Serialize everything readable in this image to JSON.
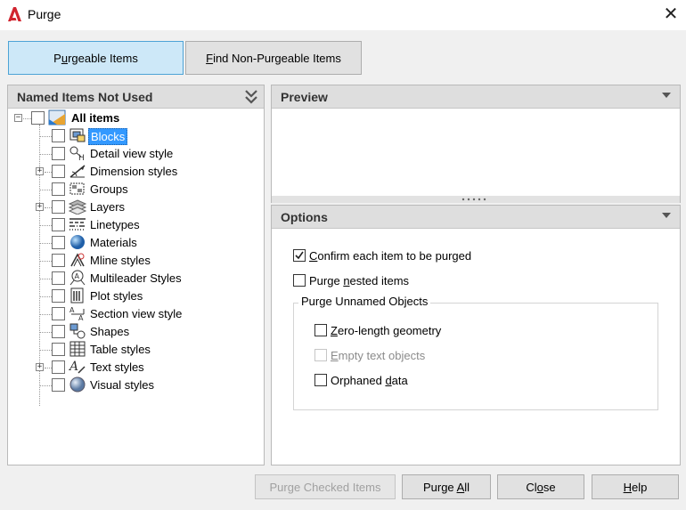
{
  "window": {
    "title": "Purge",
    "close_glyph": "✕"
  },
  "tabs": [
    {
      "label": "Purgeable Items",
      "mnemonic": "u",
      "active": true
    },
    {
      "label": "Find Non-Purgeable Items",
      "mnemonic": "F",
      "active": false
    }
  ],
  "left_panel": {
    "header": "Named Items Not Used",
    "tree": {
      "root_label": "All items",
      "items": [
        {
          "label": "Blocks",
          "icon": "block-icon",
          "expandable": false,
          "selected": true
        },
        {
          "label": "Detail view style",
          "icon": "detail-view-style-icon",
          "expandable": false
        },
        {
          "label": "Dimension styles",
          "icon": "dimension-styles-icon",
          "expandable": true
        },
        {
          "label": "Groups",
          "icon": "groups-icon",
          "expandable": false
        },
        {
          "label": "Layers",
          "icon": "layers-icon",
          "expandable": true
        },
        {
          "label": "Linetypes",
          "icon": "linetypes-icon",
          "expandable": false
        },
        {
          "label": "Materials",
          "icon": "materials-icon",
          "expandable": false
        },
        {
          "label": "Mline styles",
          "icon": "mline-styles-icon",
          "expandable": false
        },
        {
          "label": "Multileader Styles",
          "icon": "multileader-styles-icon",
          "expandable": false
        },
        {
          "label": "Plot styles",
          "icon": "plot-styles-icon",
          "expandable": false
        },
        {
          "label": "Section view style",
          "icon": "section-view-style-icon",
          "expandable": false
        },
        {
          "label": "Shapes",
          "icon": "shapes-icon",
          "expandable": false
        },
        {
          "label": "Table styles",
          "icon": "table-styles-icon",
          "expandable": false
        },
        {
          "label": "Text styles",
          "icon": "text-styles-icon",
          "expandable": true
        },
        {
          "label": "Visual styles",
          "icon": "visual-styles-icon",
          "expandable": false
        }
      ]
    }
  },
  "preview_panel": {
    "header": "Preview"
  },
  "options_panel": {
    "header": "Options",
    "confirm_each": {
      "label": "Confirm each item to be purged",
      "checked": true
    },
    "purge_nested": {
      "label": "Purge nested items",
      "checked": false
    },
    "unnamed_group": {
      "title": "Purge Unnamed Objects",
      "zero_length": {
        "label": "Zero-length geometry",
        "checked": false,
        "enabled": true
      },
      "empty_text": {
        "label": "Empty text objects",
        "checked": false,
        "enabled": false
      },
      "orphaned": {
        "label": "Orphaned data",
        "checked": false,
        "enabled": true
      }
    }
  },
  "buttons": {
    "purge_checked": "Purge Checked Items",
    "purge_all": "Purge All",
    "close": "Close",
    "help": "Help"
  },
  "colors": {
    "accent": "#3399ff",
    "active_tab": "#cde8f8",
    "header_bg": "#dedede",
    "app_red": "#d1242f"
  }
}
